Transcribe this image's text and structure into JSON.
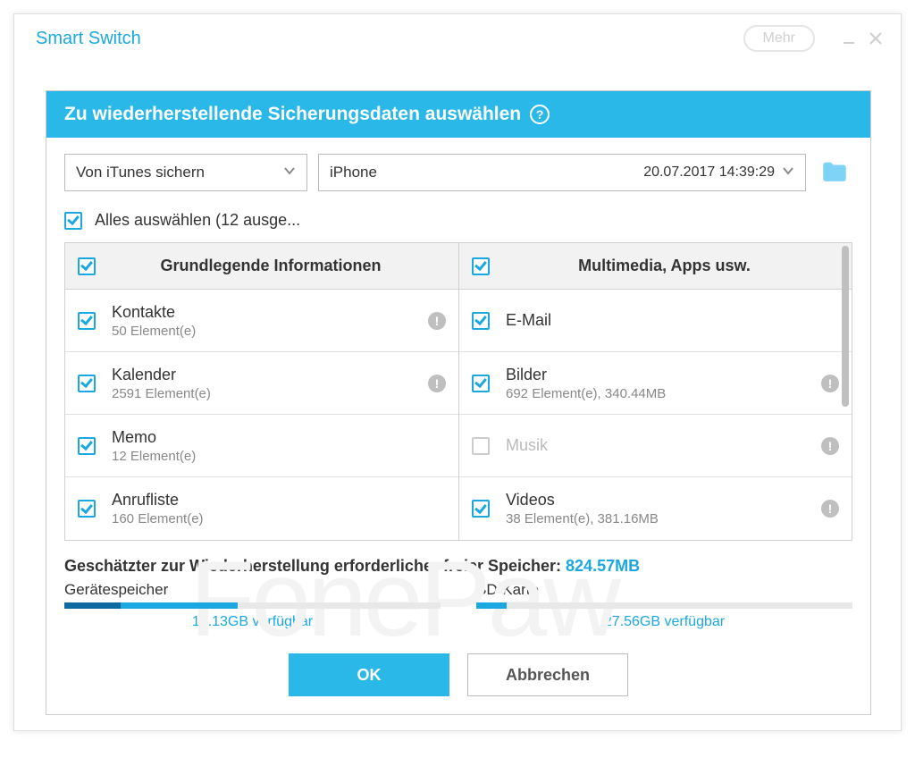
{
  "app_title": "Smart Switch",
  "titlebar": {
    "more_label": "Mehr"
  },
  "dialog": {
    "title": "Zu wiederherstellende Sicherungsdaten auswählen"
  },
  "dropdown1": {
    "label": "Von iTunes sichern"
  },
  "dropdown2": {
    "device": "iPhone",
    "timestamp": "20.07.2017 14:39:29"
  },
  "select_all": {
    "label": "Alles auswählen (12 ausge..."
  },
  "columns": {
    "left": {
      "header": "Grundlegende Informationen"
    },
    "right": {
      "header": "Multimedia, Apps usw."
    }
  },
  "left_items": [
    {
      "title": "Kontakte",
      "sub": "50 Element(e)",
      "info": true
    },
    {
      "title": "Kalender",
      "sub": "2591 Element(e)",
      "info": true
    },
    {
      "title": "Memo",
      "sub": "12 Element(e)",
      "info": false
    },
    {
      "title": "Anrufliste",
      "sub": "160 Element(e)",
      "info": false
    }
  ],
  "right_items": [
    {
      "title": "E-Mail",
      "sub": "",
      "info": false,
      "checked": true
    },
    {
      "title": "Bilder",
      "sub": "692 Element(e), 340.44MB",
      "info": true,
      "checked": true
    },
    {
      "title": "Musik",
      "sub": "",
      "info": true,
      "checked": false,
      "disabled": true
    },
    {
      "title": "Videos",
      "sub": "38 Element(e), 381.16MB",
      "info": true,
      "checked": true
    }
  ],
  "storage": {
    "estimate_label": "Geschätzter zur Wiederherstellung erforderlicher freier Speicher:",
    "estimate_value": "824.57MB",
    "device_label": "Gerätespeicher",
    "device_avail": "16.13GB verfügbar",
    "sd_label": "SD-Karte",
    "sd_avail": "27.56GB verfügbar"
  },
  "buttons": {
    "ok": "OK",
    "cancel": "Abbrechen"
  },
  "watermark": "FonePaw"
}
